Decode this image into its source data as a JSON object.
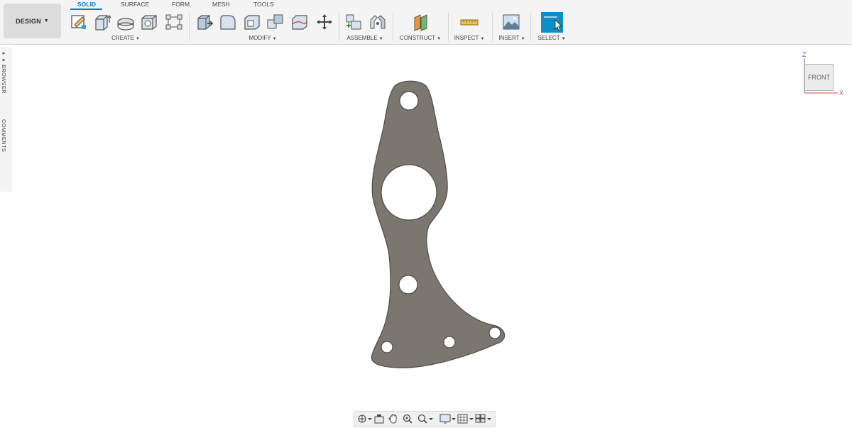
{
  "workspace": {
    "label": "DESIGN"
  },
  "tabs": [
    {
      "label": "SOLID",
      "active": true
    },
    {
      "label": "SURFACE",
      "active": false
    },
    {
      "label": "FORM",
      "active": false
    },
    {
      "label": "MESH",
      "active": false
    },
    {
      "label": "TOOLS",
      "active": false
    }
  ],
  "groups": {
    "create": "CREATE",
    "modify": "MODIFY",
    "assemble": "ASSEMBLE",
    "construct": "CONSTRUCT",
    "inspect": "INSPECT",
    "insert": "INSERT",
    "select": "SELECT"
  },
  "panels": {
    "browser": "BROWSER",
    "comments": "COMMENTS"
  },
  "viewcube": {
    "face": "FRONT",
    "axis_z": "Z",
    "axis_x": "X"
  },
  "colors": {
    "accent": "#0a7cc1",
    "select_bg": "#0f8ec5",
    "part_fill": "#7b7770"
  }
}
